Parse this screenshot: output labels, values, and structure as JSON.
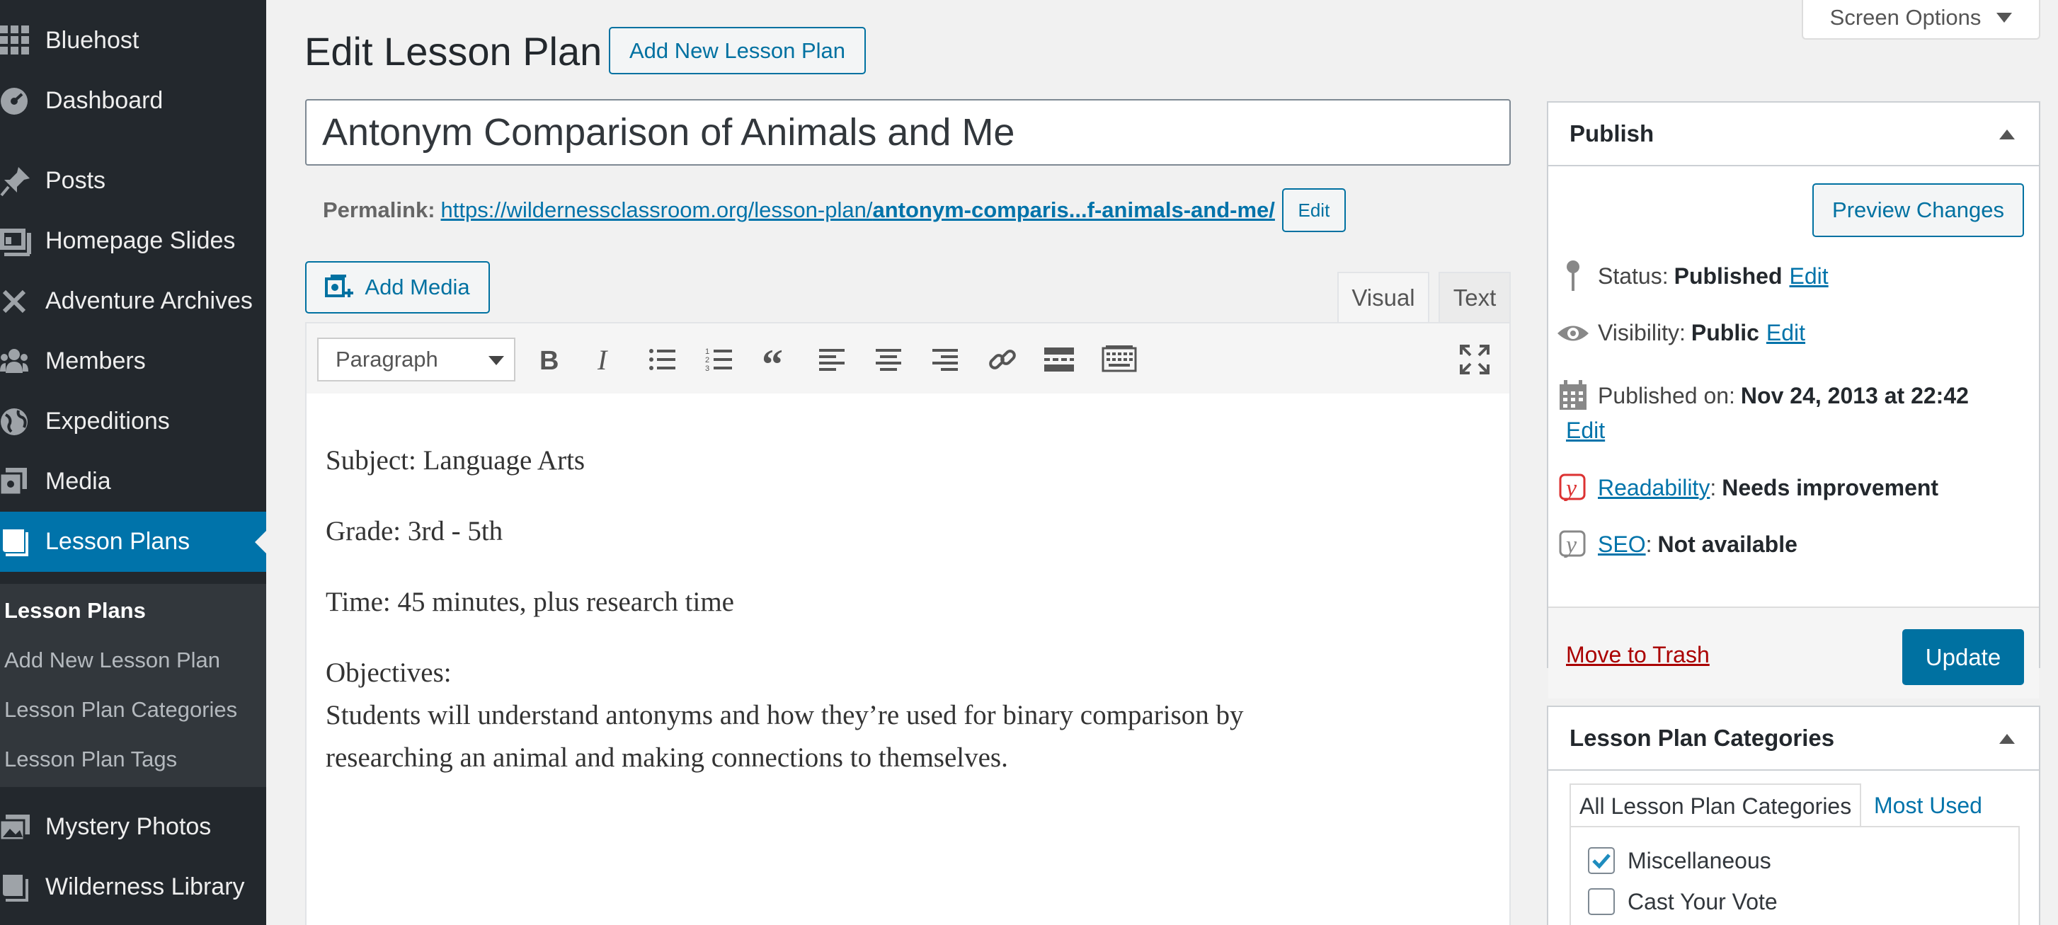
{
  "sidebar": {
    "items": [
      {
        "label": "Bluehost",
        "icon": "grid-icon"
      },
      {
        "label": "Dashboard",
        "icon": "dashboard-icon"
      },
      {
        "label": "Posts",
        "icon": "pin-icon"
      },
      {
        "label": "Homepage Slides",
        "icon": "slides-icon"
      },
      {
        "label": "Adventure Archives",
        "icon": "close-x-icon"
      },
      {
        "label": "Members",
        "icon": "members-icon"
      },
      {
        "label": "Expeditions",
        "icon": "globe-icon"
      },
      {
        "label": "Media",
        "icon": "media-icon"
      },
      {
        "label": "Lesson Plans",
        "icon": "book-icon"
      },
      {
        "label": "Mystery Photos",
        "icon": "photos-icon"
      },
      {
        "label": "Wilderness Library",
        "icon": "library-icon"
      }
    ],
    "submenu": [
      "Lesson Plans",
      "Add New Lesson Plan",
      "Lesson Plan Categories",
      "Lesson Plan Tags"
    ]
  },
  "header": {
    "title": "Edit Lesson Plan",
    "add_new": "Add New Lesson Plan",
    "screen_options": "Screen Options"
  },
  "post": {
    "title": "Antonym Comparison of Animals and Me",
    "permalink_label": "Permalink:",
    "permalink_base": "https://wildernessclassroom.org/lesson-plan/",
    "permalink_slug": "antonym-comparis...f-animals-and-me/",
    "permalink_edit": "Edit"
  },
  "editor": {
    "add_media": "Add Media",
    "tab_visual": "Visual",
    "tab_text": "Text",
    "format": "Paragraph",
    "content": [
      "Subject: Language Arts",
      "Grade: 3rd - 5th",
      "Time: 45 minutes, plus research time",
      "Objectives:",
      "Students will understand antonyms and how they’re used for binary comparison by",
      "researching an animal and making connections to themselves."
    ]
  },
  "publish": {
    "title": "Publish",
    "preview": "Preview Changes",
    "status_label": "Status:",
    "status_value": "Published",
    "visibility_label": "Visibility:",
    "visibility_value": "Public",
    "published_label": "Published on:",
    "published_value": "Nov 24, 2013 at 22:42",
    "edit": "Edit",
    "readability_link": "Readability",
    "readability_value": "Needs improvement",
    "seo_link": "SEO",
    "seo_value": "Not available",
    "trash": "Move to Trash",
    "update": "Update"
  },
  "categories": {
    "title": "Lesson Plan Categories",
    "tab_all": "All Lesson Plan Categories",
    "tab_most_used": "Most Used",
    "items": [
      {
        "label": "Miscellaneous",
        "checked": true
      },
      {
        "label": "Cast Your Vote",
        "checked": false
      }
    ]
  },
  "colors": {
    "sidebar_bg": "#23282d",
    "accent": "#0073aa",
    "trash": "#a00",
    "readability_icon": "#dc3232"
  }
}
